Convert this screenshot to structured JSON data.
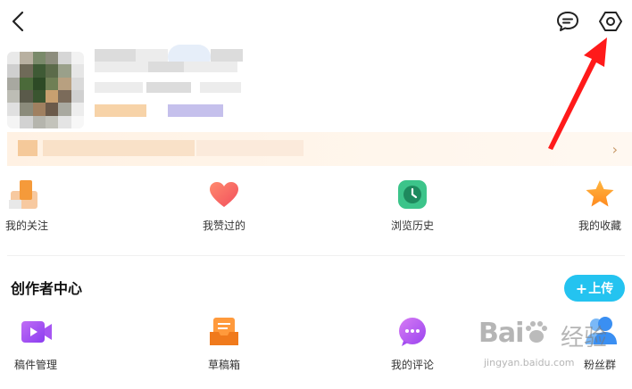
{
  "follow_label": "我的关注",
  "entries": [
    {
      "label": "我赞过的",
      "icon": "heart-icon"
    },
    {
      "label": "浏览历史",
      "icon": "clock-icon"
    },
    {
      "label": "我的收藏",
      "icon": "star-icon"
    }
  ],
  "creator": {
    "title": "创作者中心",
    "upload_label": "上传",
    "items": [
      {
        "label": "稿件管理",
        "icon": "video-icon"
      },
      {
        "label": "草稿箱",
        "icon": "draft-box-icon"
      },
      {
        "label": "我的评论",
        "icon": "comment-icon"
      },
      {
        "label": "粉丝群",
        "icon": "fans-group-icon"
      }
    ]
  },
  "watermark": {
    "logo": "Bai",
    "logo_suffix": "经验",
    "url": "jingyan.baidu.com"
  },
  "colors": {
    "accent": "#24c3f0",
    "annotation_arrow": "#ff1a1a"
  }
}
